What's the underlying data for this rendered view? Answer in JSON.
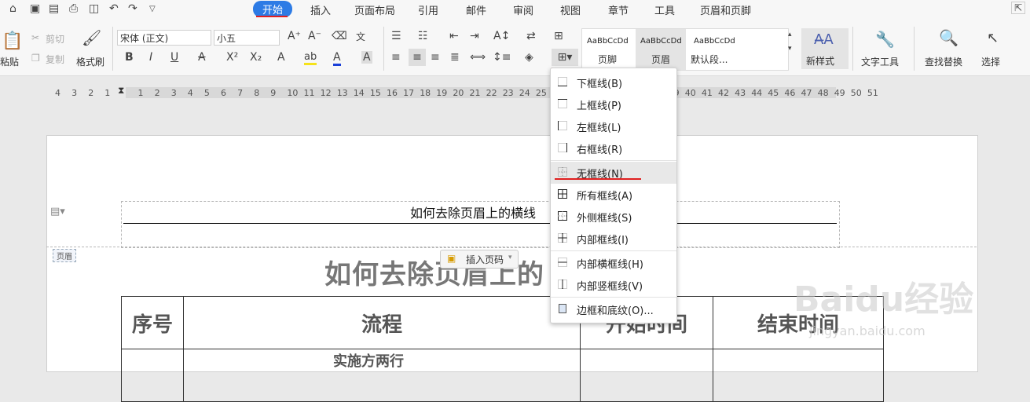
{
  "tabs": [
    "开始",
    "插入",
    "页面布局",
    "引用",
    "邮件",
    "审阅",
    "视图",
    "章节",
    "工具",
    "页眉和页脚"
  ],
  "ribbon": {
    "paste": "粘贴",
    "cut": "剪切",
    "copy": "复制",
    "format_painter": "格式刷",
    "font_name": "宋体 (正文)",
    "font_size": "小五",
    "styles": [
      {
        "sample": "AaBbCcDd",
        "name": "页脚"
      },
      {
        "sample": "AaBbCcDd",
        "name": "页眉"
      },
      {
        "sample": "AaBbCcDd",
        "name": "默认段..."
      }
    ],
    "new_style": "新样式",
    "text_tools": "文字工具",
    "find_replace": "查找替换",
    "select": "选择"
  },
  "ruler_numbers": [
    "4",
    "3",
    "2",
    "1",
    "",
    "1",
    "2",
    "3",
    "4",
    "5",
    "6",
    "7",
    "8",
    "9",
    "10",
    "11",
    "12",
    "13",
    "14",
    "15",
    "16",
    "17",
    "18",
    "19",
    "20",
    "21",
    "22",
    "23",
    "24",
    "25",
    "26",
    "",
    "34",
    "35",
    "36",
    "37",
    "38",
    "39",
    "40",
    "41",
    "42",
    "43",
    "44",
    "45",
    "46",
    "47",
    "48",
    "49",
    "50",
    "51"
  ],
  "document": {
    "header_text": "如何去除页眉上的横线",
    "header_tag": "页眉",
    "insert_page_number": "插入页码",
    "title": "如何去除页眉上的",
    "table_headers": [
      "序号",
      "流程",
      "开始时间",
      "结束时间"
    ],
    "table_row2_partial": "实施方两行"
  },
  "border_menu": {
    "items": [
      {
        "label": "下框线(B)",
        "icon": "bottom-border-icon"
      },
      {
        "label": "上框线(P)",
        "icon": "top-border-icon"
      },
      {
        "label": "左框线(L)",
        "icon": "left-border-icon"
      },
      {
        "label": "右框线(R)",
        "icon": "right-border-icon"
      },
      {
        "label": "无框线(N)",
        "icon": "no-border-icon"
      },
      {
        "label": "所有框线(A)",
        "icon": "all-borders-icon"
      },
      {
        "label": "外侧框线(S)",
        "icon": "outside-borders-icon"
      },
      {
        "label": "内部框线(I)",
        "icon": "inside-borders-icon"
      },
      {
        "label": "内部横框线(H)",
        "icon": "inside-horizontal-border-icon"
      },
      {
        "label": "内部竖框线(V)",
        "icon": "inside-vertical-border-icon"
      },
      {
        "label": "边框和底纹(O)...",
        "icon": "borders-shading-icon"
      }
    ],
    "highlighted": "无框线(N)"
  },
  "watermark": {
    "brand": "Baidu经验",
    "url": "jingyan.baidu.com"
  },
  "colors": {
    "accent": "#2d7be5",
    "annotation_red": "#e02020"
  }
}
